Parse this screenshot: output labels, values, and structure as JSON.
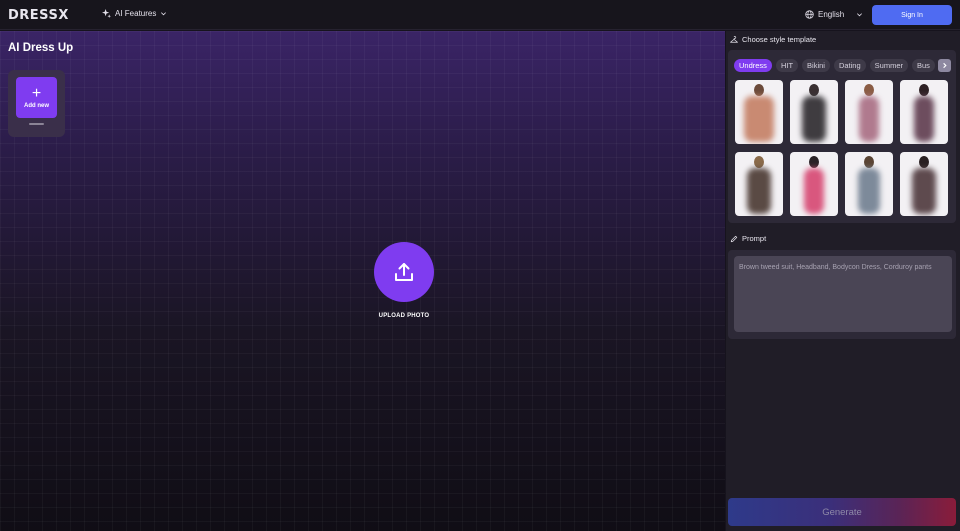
{
  "header": {
    "logo": "DRESSX",
    "ai_features_label": "AI Features",
    "language": "English",
    "signin_label": "Sign In"
  },
  "main": {
    "title": "AI Dress Up",
    "add_new_plus": "+",
    "add_new_label": "Add new",
    "upload_label": "UPLOAD PHOTO"
  },
  "sidebar": {
    "style_title": "Choose style template",
    "tabs": [
      {
        "label": "Undress",
        "active": true
      },
      {
        "label": "HIT",
        "active": false
      },
      {
        "label": "Bikini",
        "active": false
      },
      {
        "label": "Dating",
        "active": false
      },
      {
        "label": "Summer",
        "active": false
      },
      {
        "label": "Bus",
        "active": false
      }
    ],
    "prompt_title": "Prompt",
    "prompt_placeholder": "Brown tweed suit, Headband, Bodycon Dress, Corduroy pants",
    "generate_label": "Generate"
  },
  "colors": {
    "accent": "#7f3cf0",
    "signin": "#4f6bf2",
    "panel": "#2d2937"
  }
}
